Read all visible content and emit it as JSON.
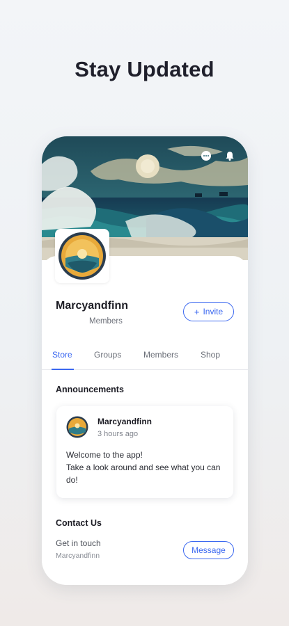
{
  "headline": "Stay Updated",
  "header": {
    "icons": [
      "chat-icon",
      "bell-icon"
    ]
  },
  "profile": {
    "name": "Marcyandfinn",
    "subtitle": "Members",
    "invite_label": "Invite"
  },
  "tabs": [
    {
      "label": "Store",
      "active": true
    },
    {
      "label": "Groups",
      "active": false
    },
    {
      "label": "Members",
      "active": false
    },
    {
      "label": "Shop",
      "active": false
    }
  ],
  "announcements": {
    "title": "Announcements",
    "post": {
      "author": "Marcyandfinn",
      "time": "3 hours ago",
      "line1": "Welcome to the app!",
      "line2": "Take a look around and see what you can do!"
    }
  },
  "contact": {
    "title": "Contact Us",
    "label": "Get in touch",
    "sub": "Marcyandfinn",
    "message_label": "Message"
  },
  "colors": {
    "accent": "#3b68f0",
    "text": "#1c1c24"
  }
}
